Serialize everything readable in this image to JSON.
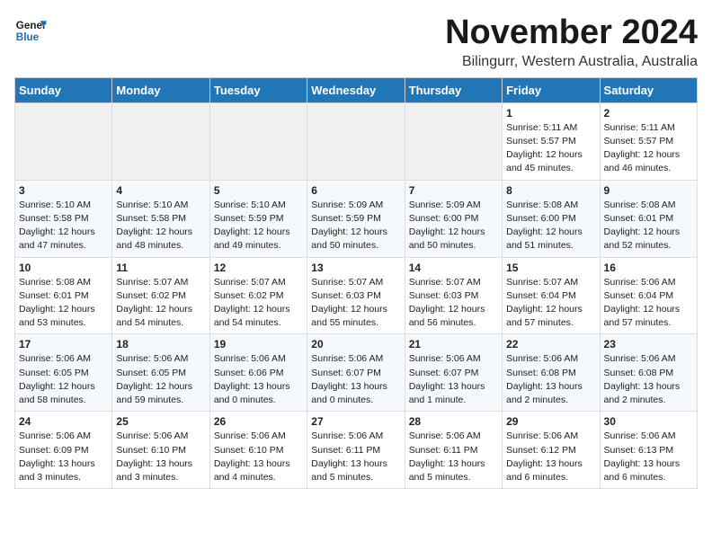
{
  "logo": {
    "text_general": "General",
    "text_blue": "Blue"
  },
  "header": {
    "title": "November 2024",
    "subtitle": "Bilingurr, Western Australia, Australia"
  },
  "columns": [
    "Sunday",
    "Monday",
    "Tuesday",
    "Wednesday",
    "Thursday",
    "Friday",
    "Saturday"
  ],
  "weeks": [
    [
      {
        "day": "",
        "info": ""
      },
      {
        "day": "",
        "info": ""
      },
      {
        "day": "",
        "info": ""
      },
      {
        "day": "",
        "info": ""
      },
      {
        "day": "",
        "info": ""
      },
      {
        "day": "1",
        "info": "Sunrise: 5:11 AM\nSunset: 5:57 PM\nDaylight: 12 hours\nand 45 minutes."
      },
      {
        "day": "2",
        "info": "Sunrise: 5:11 AM\nSunset: 5:57 PM\nDaylight: 12 hours\nand 46 minutes."
      }
    ],
    [
      {
        "day": "3",
        "info": "Sunrise: 5:10 AM\nSunset: 5:58 PM\nDaylight: 12 hours\nand 47 minutes."
      },
      {
        "day": "4",
        "info": "Sunrise: 5:10 AM\nSunset: 5:58 PM\nDaylight: 12 hours\nand 48 minutes."
      },
      {
        "day": "5",
        "info": "Sunrise: 5:10 AM\nSunset: 5:59 PM\nDaylight: 12 hours\nand 49 minutes."
      },
      {
        "day": "6",
        "info": "Sunrise: 5:09 AM\nSunset: 5:59 PM\nDaylight: 12 hours\nand 50 minutes."
      },
      {
        "day": "7",
        "info": "Sunrise: 5:09 AM\nSunset: 6:00 PM\nDaylight: 12 hours\nand 50 minutes."
      },
      {
        "day": "8",
        "info": "Sunrise: 5:08 AM\nSunset: 6:00 PM\nDaylight: 12 hours\nand 51 minutes."
      },
      {
        "day": "9",
        "info": "Sunrise: 5:08 AM\nSunset: 6:01 PM\nDaylight: 12 hours\nand 52 minutes."
      }
    ],
    [
      {
        "day": "10",
        "info": "Sunrise: 5:08 AM\nSunset: 6:01 PM\nDaylight: 12 hours\nand 53 minutes."
      },
      {
        "day": "11",
        "info": "Sunrise: 5:07 AM\nSunset: 6:02 PM\nDaylight: 12 hours\nand 54 minutes."
      },
      {
        "day": "12",
        "info": "Sunrise: 5:07 AM\nSunset: 6:02 PM\nDaylight: 12 hours\nand 54 minutes."
      },
      {
        "day": "13",
        "info": "Sunrise: 5:07 AM\nSunset: 6:03 PM\nDaylight: 12 hours\nand 55 minutes."
      },
      {
        "day": "14",
        "info": "Sunrise: 5:07 AM\nSunset: 6:03 PM\nDaylight: 12 hours\nand 56 minutes."
      },
      {
        "day": "15",
        "info": "Sunrise: 5:07 AM\nSunset: 6:04 PM\nDaylight: 12 hours\nand 57 minutes."
      },
      {
        "day": "16",
        "info": "Sunrise: 5:06 AM\nSunset: 6:04 PM\nDaylight: 12 hours\nand 57 minutes."
      }
    ],
    [
      {
        "day": "17",
        "info": "Sunrise: 5:06 AM\nSunset: 6:05 PM\nDaylight: 12 hours\nand 58 minutes."
      },
      {
        "day": "18",
        "info": "Sunrise: 5:06 AM\nSunset: 6:05 PM\nDaylight: 12 hours\nand 59 minutes."
      },
      {
        "day": "19",
        "info": "Sunrise: 5:06 AM\nSunset: 6:06 PM\nDaylight: 13 hours\nand 0 minutes."
      },
      {
        "day": "20",
        "info": "Sunrise: 5:06 AM\nSunset: 6:07 PM\nDaylight: 13 hours\nand 0 minutes."
      },
      {
        "day": "21",
        "info": "Sunrise: 5:06 AM\nSunset: 6:07 PM\nDaylight: 13 hours\nand 1 minute."
      },
      {
        "day": "22",
        "info": "Sunrise: 5:06 AM\nSunset: 6:08 PM\nDaylight: 13 hours\nand 2 minutes."
      },
      {
        "day": "23",
        "info": "Sunrise: 5:06 AM\nSunset: 6:08 PM\nDaylight: 13 hours\nand 2 minutes."
      }
    ],
    [
      {
        "day": "24",
        "info": "Sunrise: 5:06 AM\nSunset: 6:09 PM\nDaylight: 13 hours\nand 3 minutes."
      },
      {
        "day": "25",
        "info": "Sunrise: 5:06 AM\nSunset: 6:10 PM\nDaylight: 13 hours\nand 3 minutes."
      },
      {
        "day": "26",
        "info": "Sunrise: 5:06 AM\nSunset: 6:10 PM\nDaylight: 13 hours\nand 4 minutes."
      },
      {
        "day": "27",
        "info": "Sunrise: 5:06 AM\nSunset: 6:11 PM\nDaylight: 13 hours\nand 5 minutes."
      },
      {
        "day": "28",
        "info": "Sunrise: 5:06 AM\nSunset: 6:11 PM\nDaylight: 13 hours\nand 5 minutes."
      },
      {
        "day": "29",
        "info": "Sunrise: 5:06 AM\nSunset: 6:12 PM\nDaylight: 13 hours\nand 6 minutes."
      },
      {
        "day": "30",
        "info": "Sunrise: 5:06 AM\nSunset: 6:13 PM\nDaylight: 13 hours\nand 6 minutes."
      }
    ]
  ]
}
